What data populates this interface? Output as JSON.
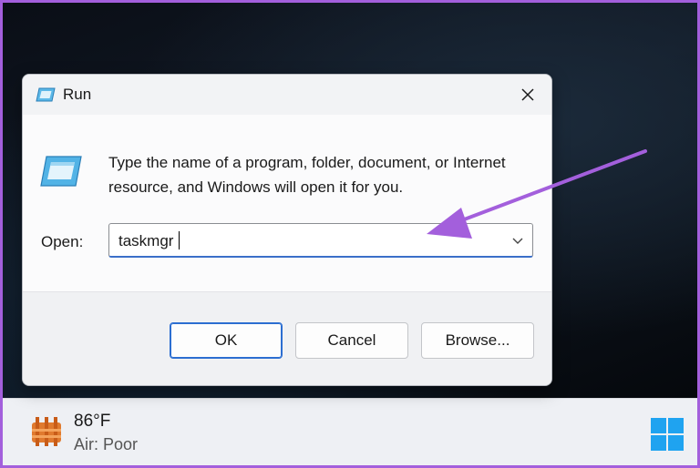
{
  "dialog": {
    "title": "Run",
    "description": "Type the name of a program, folder, document, or Internet resource, and Windows will open it for you.",
    "open_label": "Open:",
    "open_value": "taskmgr",
    "buttons": {
      "ok": "OK",
      "cancel": "Cancel",
      "browse": "Browse..."
    }
  },
  "taskbar": {
    "weather": {
      "temperature": "86°F",
      "condition": "Air: Poor"
    }
  },
  "icons": {
    "title": "run-icon",
    "close": "close-icon",
    "dropdown": "chevron-down-icon",
    "weather": "weather-icon",
    "start": "windows-start-icon"
  },
  "colors": {
    "annotation_arrow": "#a35fdc",
    "accent": "#2c6ed1"
  }
}
